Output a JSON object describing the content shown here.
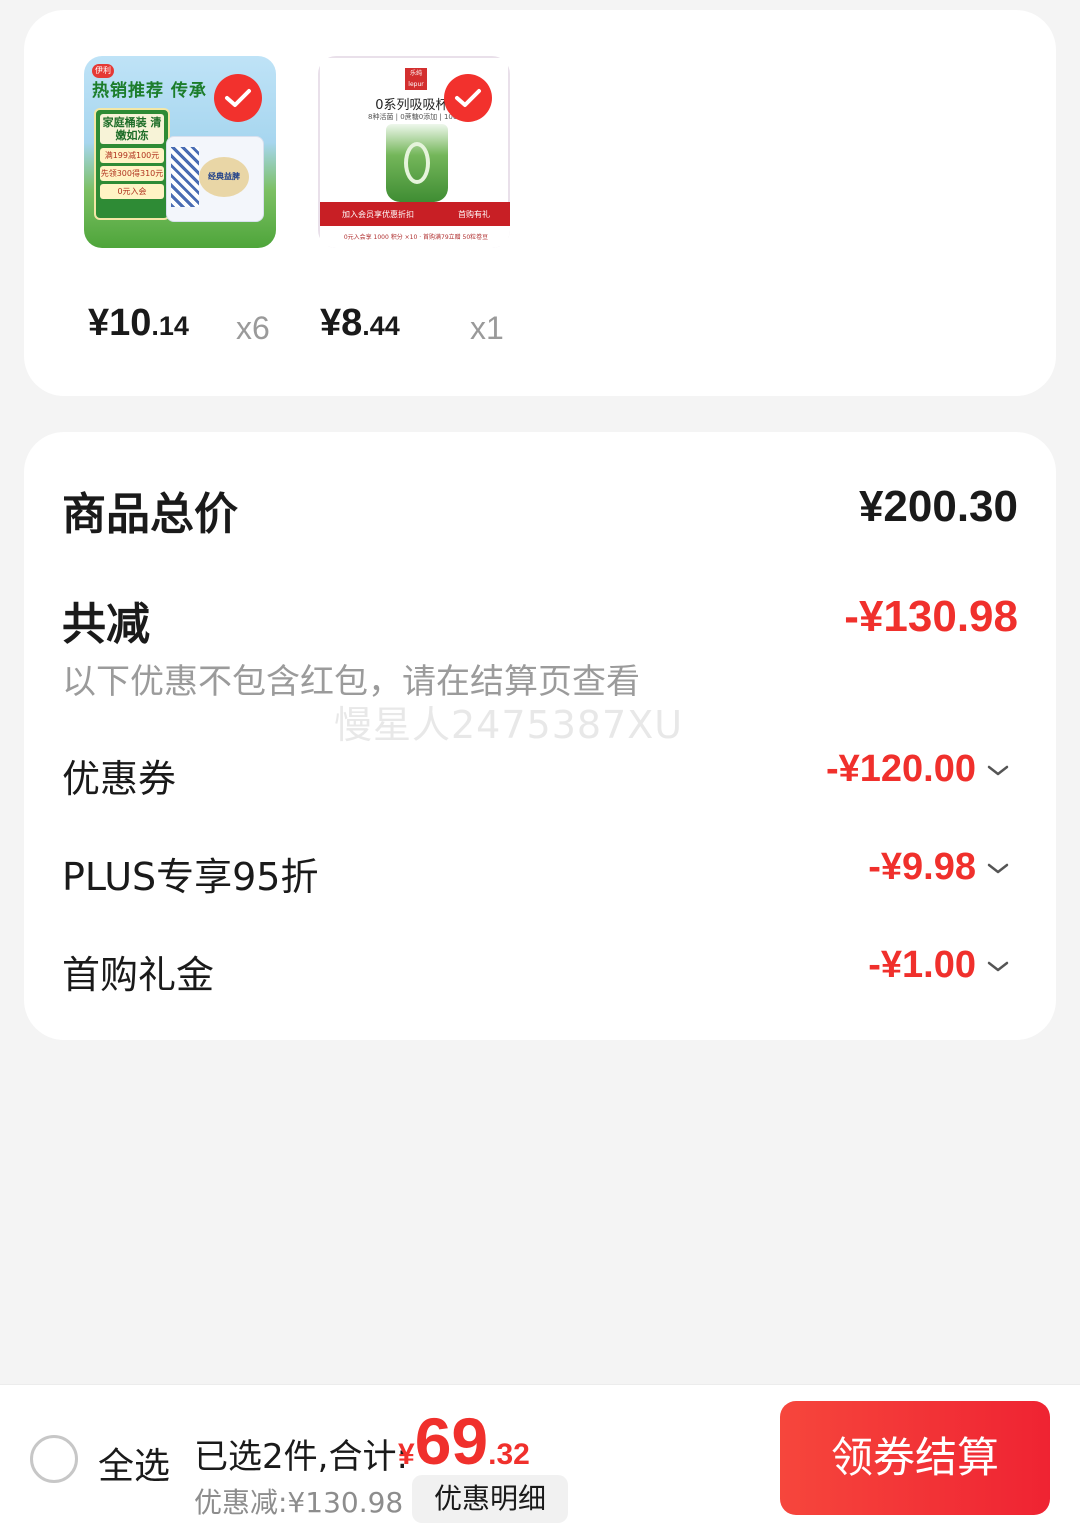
{
  "products": [
    {
      "name": "yili-family-tub",
      "thumb_banner": "热销推荐 传承",
      "thumb_logo": "伊利",
      "thumb_panel_title": "家庭桶装 清嫩如冻",
      "thumb_panel_line1": "满199减100元",
      "thumb_panel_line2": "先领300得310元",
      "thumb_panel_line3": "0元入会",
      "thumb_tub_label": "经典益脾",
      "price_int": "¥10",
      "price_dec": ".14",
      "quantity": "x6",
      "selected": true
    },
    {
      "name": "lepur-cup",
      "thumb_brand": "乐纯 lepur",
      "thumb_headline": "0系列吸吸杯1",
      "thumb_sub": "8种活菌 | 0蔗糖0添加 | 100%",
      "thumb_strip_left": "加入会员享优惠折扣",
      "thumb_strip_right": "首购有礼",
      "thumb_footer": "0元入会享 1000 积分 ×10 · 首购满79立赠 50粒卷豆",
      "price_int": "¥8",
      "price_dec": ".44",
      "quantity": "x1",
      "selected": true
    }
  ],
  "summary": {
    "total_label": "商品总价",
    "total_value": "¥200.30",
    "reduce_label": "共减",
    "reduce_value": "-¥130.98",
    "hint": "以下优惠不包含红包，请在结算页查看",
    "watermark": "慢星人2475387XU",
    "discounts": [
      {
        "label": "优惠券",
        "value": "-¥120.00"
      },
      {
        "label": "PLUS专享95折",
        "value": "-¥9.98"
      },
      {
        "label": "首购礼金",
        "value": "-¥1.00"
      }
    ]
  },
  "bottom": {
    "select_all": "全选",
    "selected_text": "已选2件,合计:",
    "grand_currency": "¥",
    "grand_int": "69",
    "grand_dec": ".32",
    "saved": "优惠减:¥130.98",
    "detail_button": "优惠明细",
    "checkout_button": "领券结算"
  },
  "colors": {
    "accent": "#f0302c",
    "background": "#f4f4f4",
    "card": "#ffffff"
  }
}
